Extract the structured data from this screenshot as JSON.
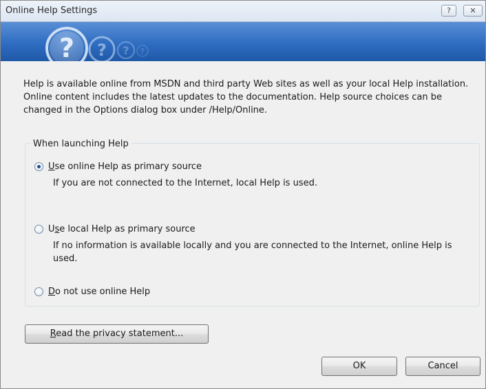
{
  "window": {
    "title": "Online Help Settings",
    "help_button": "?",
    "close_button": "✕"
  },
  "banner": {
    "icon": "help-question-icon",
    "colors": {
      "top": "#5a8fd6",
      "bottom": "#1f58a8"
    }
  },
  "intro_text": "Help is available online from MSDN and third party Web sites as well as your local Help installation. Online content includes the latest updates to the documentation. Help source choices can be changed in the Options dialog box under /Help/Online.",
  "group": {
    "legend": "When launching Help",
    "options": [
      {
        "mnemonic": "U",
        "label_rest": "se online Help as primary source",
        "description": "If you are not connected to the Internet, local Help is used.",
        "checked": true
      },
      {
        "prefix": "U",
        "mnemonic": "s",
        "label_rest": "e local Help as primary source",
        "description": "If no information is available locally and you are connected to the Internet, online Help is used.",
        "checked": false
      },
      {
        "mnemonic": "D",
        "label_rest": "o not use online Help",
        "checked": false
      }
    ]
  },
  "buttons": {
    "privacy": {
      "mnemonic": "R",
      "label_rest": "ead the privacy statement..."
    },
    "ok": "OK",
    "cancel": "Cancel"
  }
}
